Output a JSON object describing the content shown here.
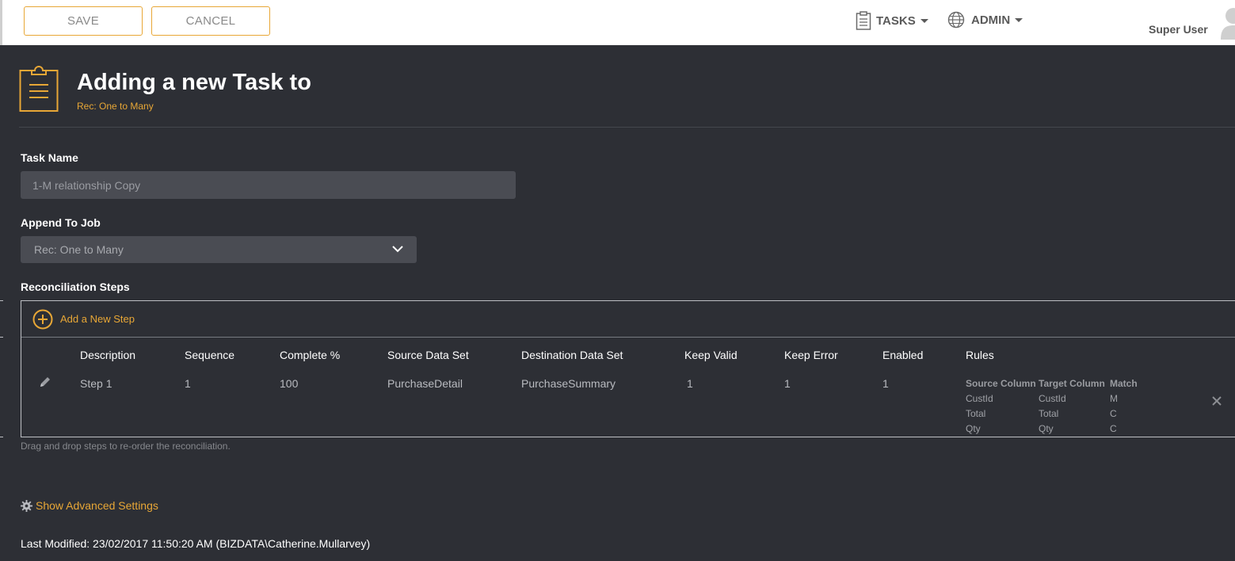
{
  "toolbar": {
    "save_label": "SAVE",
    "cancel_label": "CANCEL"
  },
  "nav": {
    "tasks_label": "TASKS",
    "admin_label": "ADMIN",
    "user_name": "Super User"
  },
  "page": {
    "title": "Adding a new Task to",
    "subtitle": "Rec: One to Many"
  },
  "form": {
    "task_name_label": "Task Name",
    "task_name_value": "1-M relationship Copy",
    "append_label": "Append To Job",
    "append_value": "Rec: One to Many",
    "steps_label": "Reconciliation Steps"
  },
  "steps": {
    "add_label": "Add a New Step",
    "columns": [
      "Description",
      "Sequence",
      "Complete %",
      "Source Data Set",
      "Destination Data Set",
      "Keep Valid",
      "Keep Error",
      "Enabled",
      "Rules"
    ],
    "row": {
      "description": "Step 1",
      "sequence": "1",
      "complete": "100",
      "source": "PurchaseDetail",
      "destination": "PurchaseSummary",
      "keep_valid": "1",
      "keep_error": "1",
      "enabled": "1"
    },
    "rules": {
      "headers": [
        "Source Column",
        "Target Column",
        "Match"
      ],
      "rows": [
        [
          "CustId",
          "CustId",
          "M"
        ],
        [
          "Total",
          "Total",
          "C"
        ],
        [
          "Qty",
          "Qty",
          "C"
        ]
      ]
    },
    "help_text": "Drag and drop steps to re-order the reconciliation."
  },
  "footer": {
    "advanced_label": "Show Advanced Settings",
    "last_modified": "Last Modified: 23/02/2017 11:50:20 AM (BIZDATA\\Catherine.Mullarvey)"
  },
  "icons": {
    "tasks": "clipboard-icon",
    "admin": "globe-icon",
    "page": "clipboard-icon",
    "add": "plus-circle-icon",
    "edit": "pencil-icon",
    "delete": "close-icon",
    "advanced": "gear-icon"
  },
  "colors": {
    "accent": "#e8a736",
    "background": "#2d2f35",
    "field": "#4a4c53"
  }
}
